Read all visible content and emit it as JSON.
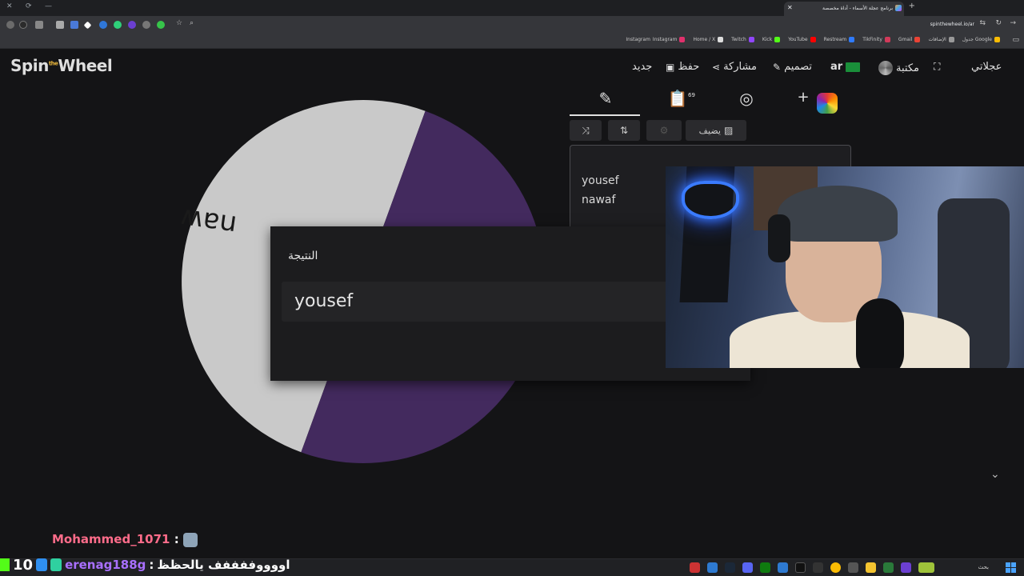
{
  "browser": {
    "tab_title": "برنامج عجلة الأسماء - أداة مخصصة",
    "url": "spinthewheel.io/ar",
    "bookmarks": [
      "Instagram",
      "Instagram",
      "Home / X",
      "Twitch",
      "Kick",
      "YouTube",
      "Restream",
      "TikFinity",
      "Gmail",
      "الإضافات",
      "جدول Google"
    ]
  },
  "app": {
    "logo_main_a": "Spin",
    "logo_the": "the",
    "logo_main_b": "Wheel",
    "nav": {
      "fast": "عجلاتي",
      "library": "مكتبة",
      "lang": "ar",
      "design": "تصميم",
      "share": "مشاركة",
      "save": "حفظ",
      "new": "جديد"
    },
    "tabs": {
      "entries_count": "69"
    },
    "actions": {
      "add_image": "يضيف"
    },
    "entries": [
      "yousef",
      "nawaf"
    ],
    "wheel": {
      "colors": [
        "#c9c9c9",
        "#432a5e"
      ],
      "visible_label": "nawaf"
    },
    "result": {
      "title": "النتيجة",
      "value": "yousef"
    }
  },
  "chat": {
    "line1_user": "Mohammed_1071",
    "line1_sep": ":",
    "line2_count": "10",
    "line2_user": "erenag188g",
    "line2_sep": ":",
    "line2_msg": "اووووففففف يالحظظ"
  },
  "taskbar": {
    "search_label": "بحث"
  }
}
